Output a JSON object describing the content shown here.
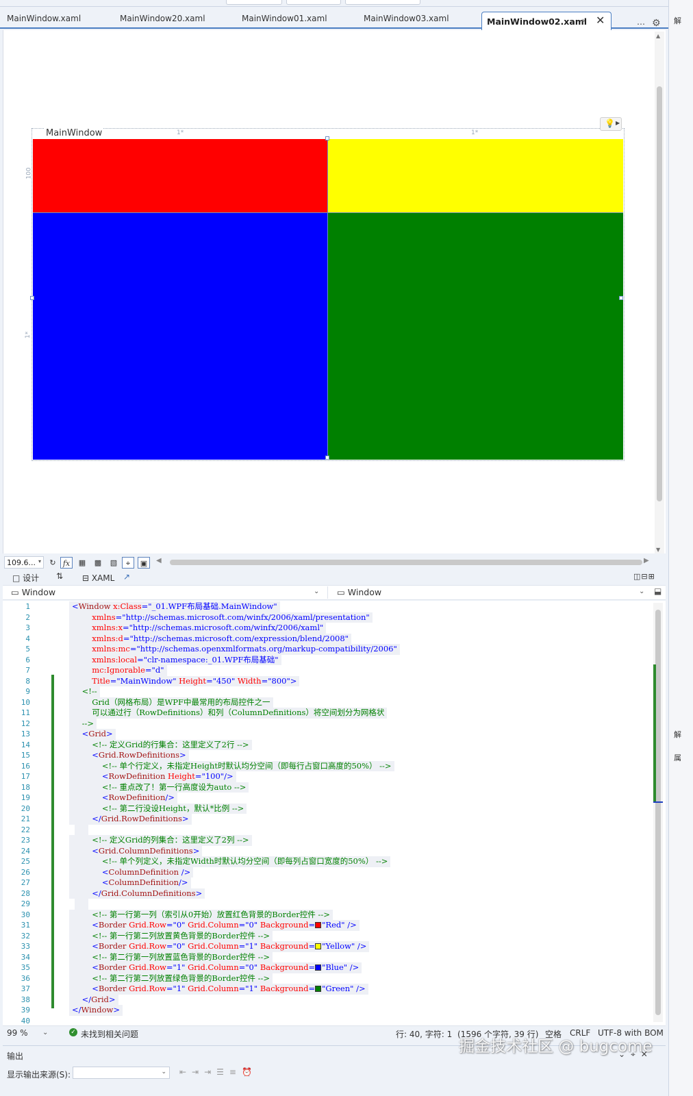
{
  "tabs": [
    {
      "label": "MainWindow.xaml"
    },
    {
      "label": "MainWindow20.xaml"
    },
    {
      "label": "MainWindow01.xaml"
    },
    {
      "label": "MainWindow03.xaml"
    },
    {
      "label": "MainWindow02.xaml",
      "active": true
    }
  ],
  "tab_icons": {
    "pin": "pin-icon",
    "close": "close-icon",
    "more": "overflow-icon",
    "settings": "gear-icon"
  },
  "designer": {
    "window_title": "MainWindow",
    "column_labels": [
      "1*",
      "1*"
    ],
    "row_labels": [
      "100",
      "1*"
    ],
    "cells": [
      {
        "row": 0,
        "column": 0,
        "color": "#ff0000"
      },
      {
        "row": 0,
        "column": 1,
        "color": "#ffff00"
      },
      {
        "row": 1,
        "column": 0,
        "color": "#0000ff"
      },
      {
        "row": 1,
        "column": 1,
        "color": "#008000"
      }
    ]
  },
  "designer_toolbar": {
    "zoom": "109.6...",
    "fx": "fx"
  },
  "split": {
    "design": "设计",
    "xaml": "XAML"
  },
  "nav": {
    "left": "Window",
    "right": "Window"
  },
  "editor": {
    "line_numbers": [
      "1",
      "2",
      "3",
      "4",
      "5",
      "6",
      "7",
      "8",
      "9",
      "10",
      "11",
      "12",
      "13",
      "14",
      "15",
      "16",
      "17",
      "18",
      "19",
      "20",
      "21",
      "22",
      "23",
      "24",
      "25",
      "26",
      "27",
      "28",
      "29",
      "30",
      "31",
      "32",
      "33",
      "34",
      "35",
      "36",
      "37",
      "38",
      "39",
      "40"
    ],
    "lines": [
      "<Window x:Class=\"_01.WPF布局基础.MainWindow\"",
      "        xmlns=\"http://schemas.microsoft.com/winfx/2006/xaml/presentation\"",
      "        xmlns:x=\"http://schemas.microsoft.com/winfx/2006/xaml\"",
      "        xmlns:d=\"http://schemas.microsoft.com/expression/blend/2008\"",
      "        xmlns:mc=\"http://schemas.openxmlformats.org/markup-compatibility/2006\"",
      "        xmlns:local=\"clr-namespace:_01.WPF布局基础\"",
      "        mc:Ignorable=\"d\"",
      "        Title=\"MainWindow\" Height=\"450\" Width=\"800\">",
      "    <!--",
      "        Grid（网格布局）是WPF中最常用的布局控件之一",
      "        可以通过行（RowDefinitions）和列（ColumnDefinitions）将空间划分为网格状",
      "    -->",
      "    <Grid>",
      "        <!-- 定义Grid的行集合：这里定义了2行 -->",
      "        <Grid.RowDefinitions>",
      "            <!-- 单个行定义，未指定Height时默认均分空间（即每行占窗口高度的50%） -->",
      "            <RowDefinition Height=\"100\"/>",
      "            <!-- 重点改了！第一行高度设为auto -->",
      "            <RowDefinition/>",
      "            <!-- 第二行没设Height，默认*比例 -->",
      "        </Grid.RowDefinitions>",
      "",
      "        <!-- 定义Grid的列集合：这里定义了2列 -->",
      "        <Grid.ColumnDefinitions>",
      "            <!-- 单个列定义，未指定Width时默认均分空间（即每列占窗口宽度的50%） -->",
      "            <ColumnDefinition />",
      "            <ColumnDefinition/>",
      "        </Grid.ColumnDefinitions>",
      "",
      "        <!-- 第一行第一列（索引从0开始）放置红色背景的Border控件 -->",
      "        <Border Grid.Row=\"0\" Grid.Column=\"0\" Background=\"Red\" />",
      "        <!-- 第一行第二列放置黄色背景的Border控件 -->",
      "        <Border Grid.Row=\"0\" Grid.Column=\"1\" Background=\"Yellow\" />",
      "        <!-- 第二行第一列放置蓝色背景的Border控件 -->",
      "        <Border Grid.Row=\"1\" Grid.Column=\"0\" Background=\"Blue\" />",
      "        <!-- 第二行第二列放置绿色背景的Border控件 -->",
      "        <Border Grid.Row=\"1\" Grid.Column=\"1\" Background=\"Green\" />",
      "    </Grid>",
      "</Window>",
      ""
    ]
  },
  "status": {
    "zoom": "99 %",
    "issues": "未找到相关问题",
    "position": "行: 40, 字符: 1",
    "chars": "(1596 个字符, 39 行)",
    "indent": "空格",
    "eol": "CRLF",
    "encoding": "UTF-8 with BOM"
  },
  "output": {
    "title": "输出",
    "source_label": "显示输出来源(S):"
  },
  "right_panel": {
    "top_label": "解",
    "mid_label": "解",
    "lower_label": "属"
  },
  "watermark": "掘金技术社区 @ bugcome"
}
